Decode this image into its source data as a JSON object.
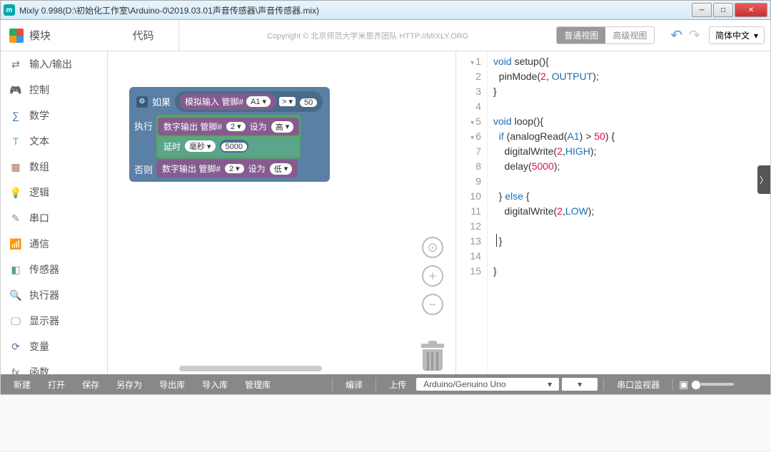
{
  "window": {
    "title": "Mixly 0.998(D:\\初始化工作室\\Arduino-0\\2019.03.01声音传感器\\声音传感器.mix)"
  },
  "header": {
    "modules": "模块",
    "code": "代码",
    "copyright": "Copyright © 北京师范大学米思齐团队 HTTP://MIXLY.ORG",
    "view_normal": "普通视图",
    "view_advanced": "高级视图",
    "language": "简体中文"
  },
  "categories": [
    {
      "label": "输入/输出",
      "color": "#855c8f",
      "icon": "⇄"
    },
    {
      "label": "控制",
      "color": "#5ba55b",
      "icon": "🎮"
    },
    {
      "label": "数学",
      "color": "#3b6fa5",
      "icon": "∑"
    },
    {
      "label": "文本",
      "color": "#5ba5a5",
      "icon": "T"
    },
    {
      "label": "数组",
      "color": "#a5745b",
      "icon": "▦"
    },
    {
      "label": "逻辑",
      "color": "#5b80a5",
      "icon": "💡"
    },
    {
      "label": "串口",
      "color": "#a5895b",
      "icon": "✎"
    },
    {
      "label": "通信",
      "color": "#a55ba5",
      "icon": "📶"
    },
    {
      "label": "传感器",
      "color": "#5ba574",
      "icon": "◧"
    },
    {
      "label": "执行器",
      "color": "#74a55b",
      "icon": "🔍"
    },
    {
      "label": "显示器",
      "color": "#5b8fa5",
      "icon": "🖵"
    },
    {
      "label": "变量",
      "color": "#805ba5",
      "icon": "⟳"
    },
    {
      "label": "函数",
      "color": "#a55b80",
      "icon": "fx"
    }
  ],
  "blocks": {
    "if": "如果",
    "do": "执行",
    "else": "否则",
    "analog_in": "模拟输入 管脚#",
    "pin_a1": "A1",
    "op": ">",
    "threshold": "50",
    "digital_out": "数字输出 管脚#",
    "pin_2": "2",
    "set_to": "设为",
    "high": "高",
    "low": "低",
    "delay": "延时",
    "ms": "毫秒",
    "delay_val": "5000"
  },
  "code_lines": [
    {
      "n": 1,
      "fold": "▾",
      "t": "void setup(){"
    },
    {
      "n": 2,
      "t": "  pinMode(2, OUTPUT);"
    },
    {
      "n": 3,
      "t": "}"
    },
    {
      "n": 4,
      "t": ""
    },
    {
      "n": 5,
      "fold": "▾",
      "t": "void loop(){"
    },
    {
      "n": 6,
      "fold": "▾",
      "t": "  if (analogRead(A1) > 50) {"
    },
    {
      "n": 7,
      "t": "    digitalWrite(2,HIGH);"
    },
    {
      "n": 8,
      "t": "    delay(5000);"
    },
    {
      "n": 9,
      "t": ""
    },
    {
      "n": 10,
      "t": "  } else {"
    },
    {
      "n": 11,
      "t": "    digitalWrite(2,LOW);"
    },
    {
      "n": 12,
      "t": ""
    },
    {
      "n": 13,
      "t": "  }"
    },
    {
      "n": 14,
      "t": ""
    },
    {
      "n": 15,
      "t": "}"
    }
  ],
  "footer": {
    "new": "新建",
    "open": "打开",
    "save": "保存",
    "save_as": "另存为",
    "export": "导出库",
    "import": "导入库",
    "manage": "管理库",
    "compile": "编译",
    "upload": "上传",
    "board": "Arduino/Genuino Uno",
    "serial_monitor": "串口监视器"
  }
}
